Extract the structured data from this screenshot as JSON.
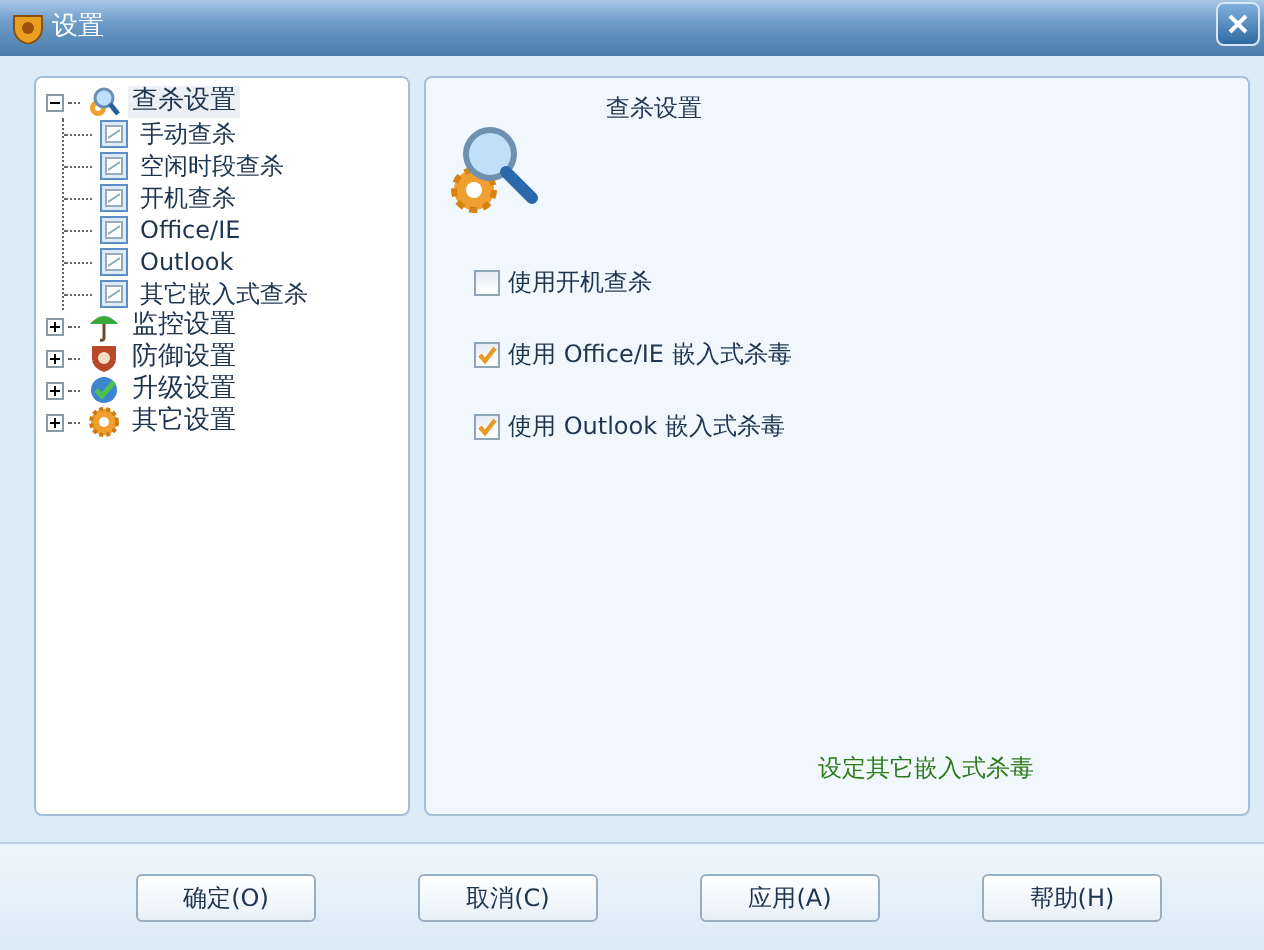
{
  "window": {
    "title": "设置"
  },
  "tree": [
    {
      "label": "查杀设置",
      "kind": "scan",
      "expanded": true,
      "selected": true,
      "children": [
        {
          "label": "手动查杀",
          "selected": false
        },
        {
          "label": "空闲时段查杀",
          "selected": false
        },
        {
          "label": "开机查杀",
          "selected": false
        },
        {
          "label": "Office/IE",
          "selected": false
        },
        {
          "label": "Outlook",
          "selected": false
        },
        {
          "label": "其它嵌入式查杀",
          "selected": false
        }
      ]
    },
    {
      "label": "监控设置",
      "kind": "monitor",
      "expanded": false,
      "selected": false
    },
    {
      "label": "防御设置",
      "kind": "defense",
      "expanded": false,
      "selected": false
    },
    {
      "label": "升级设置",
      "kind": "update",
      "expanded": false,
      "selected": false
    },
    {
      "label": "其它设置",
      "kind": "other",
      "expanded": false,
      "selected": false
    }
  ],
  "panel": {
    "heading": "查杀设置",
    "options": [
      {
        "label": "使用开机查杀",
        "checked": false
      },
      {
        "label": "使用 Office/IE 嵌入式杀毒",
        "checked": true
      },
      {
        "label": "使用 Outlook 嵌入式杀毒",
        "checked": true
      }
    ],
    "note": "设定其它嵌入式杀毒"
  },
  "buttons": [
    "确定(O)",
    "取消(C)",
    "应用(A)",
    "帮助(H)"
  ]
}
